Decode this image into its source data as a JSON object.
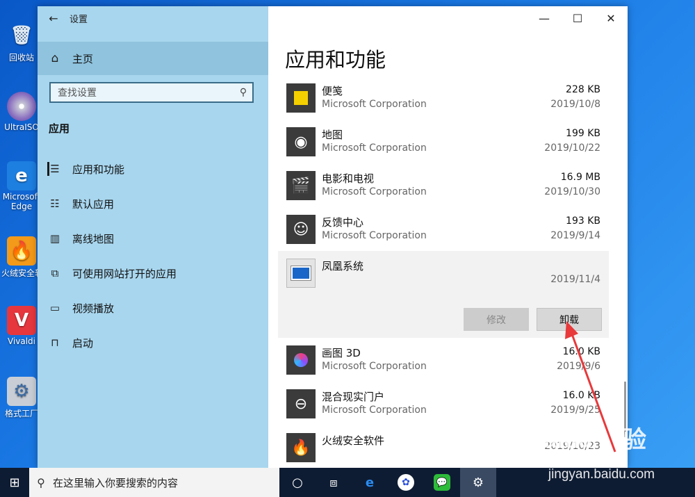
{
  "desktop": {
    "icons": [
      {
        "label": "回收站",
        "icon": "recycle-bin-icon"
      },
      {
        "label": "UltraISO",
        "icon": "ultraiso-icon"
      },
      {
        "label": "Microsoft Edge",
        "icon": "edge-icon"
      },
      {
        "label": "火绒安全软件",
        "icon": "huorong-icon"
      },
      {
        "label": "Vivaldi",
        "icon": "vivaldi-icon"
      },
      {
        "label": "格式工厂",
        "icon": "format-factory-icon"
      }
    ]
  },
  "window": {
    "title": "设置",
    "back_icon": "←",
    "minimize": "—",
    "maximize": "☐",
    "close": "✕"
  },
  "sidebar": {
    "home_label": "主页",
    "search_placeholder": "查找设置",
    "section_title": "应用",
    "items": [
      {
        "label": "应用和功能",
        "icon": "apps-features-icon",
        "selected": true
      },
      {
        "label": "默认应用",
        "icon": "default-apps-icon",
        "selected": false
      },
      {
        "label": "离线地图",
        "icon": "offline-maps-icon",
        "selected": false
      },
      {
        "label": "可使用网站打开的应用",
        "icon": "apps-for-websites-icon",
        "selected": false
      },
      {
        "label": "视频播放",
        "icon": "video-playback-icon",
        "selected": false
      },
      {
        "label": "启动",
        "icon": "startup-icon",
        "selected": false
      }
    ]
  },
  "main": {
    "page_title": "应用和功能",
    "apps": [
      {
        "name": "便笺",
        "publisher": "Microsoft Corporation",
        "size": "228 KB",
        "date": "2019/10/8",
        "icon": "sticky-notes-icon"
      },
      {
        "name": "地图",
        "publisher": "Microsoft Corporation",
        "size": "199 KB",
        "date": "2019/10/22",
        "icon": "maps-icon"
      },
      {
        "name": "电影和电视",
        "publisher": "Microsoft Corporation",
        "size": "16.9 MB",
        "date": "2019/10/30",
        "icon": "movies-tv-icon"
      },
      {
        "name": "反馈中心",
        "publisher": "Microsoft Corporation",
        "size": "193 KB",
        "date": "2019/9/14",
        "icon": "feedback-hub-icon"
      },
      {
        "name": "凤凰系统",
        "publisher": "",
        "size": "",
        "date": "2019/11/4",
        "icon": "phoenix-os-icon",
        "expanded": true,
        "modify_label": "修改",
        "uninstall_label": "卸载"
      },
      {
        "name": "画图 3D",
        "publisher": "Microsoft Corporation",
        "size": "16.0 KB",
        "date": "2019/9/6",
        "icon": "paint-3d-icon"
      },
      {
        "name": "混合现实门户",
        "publisher": "Microsoft Corporation",
        "size": "16.0 KB",
        "date": "2019/9/25",
        "icon": "mixed-reality-icon"
      },
      {
        "name": "火绒安全软件",
        "publisher": "",
        "size": "",
        "date": "2019/10/23",
        "icon": "huorong-icon"
      }
    ]
  },
  "taskbar": {
    "search_placeholder": "在这里输入你要搜索的内容"
  },
  "watermark": {
    "text": "Baidu 经验",
    "url": "jingyan.baidu.com"
  },
  "colors": {
    "sidebar_bg": "#a8d6ee",
    "accent_arrow": "#e8393b"
  }
}
